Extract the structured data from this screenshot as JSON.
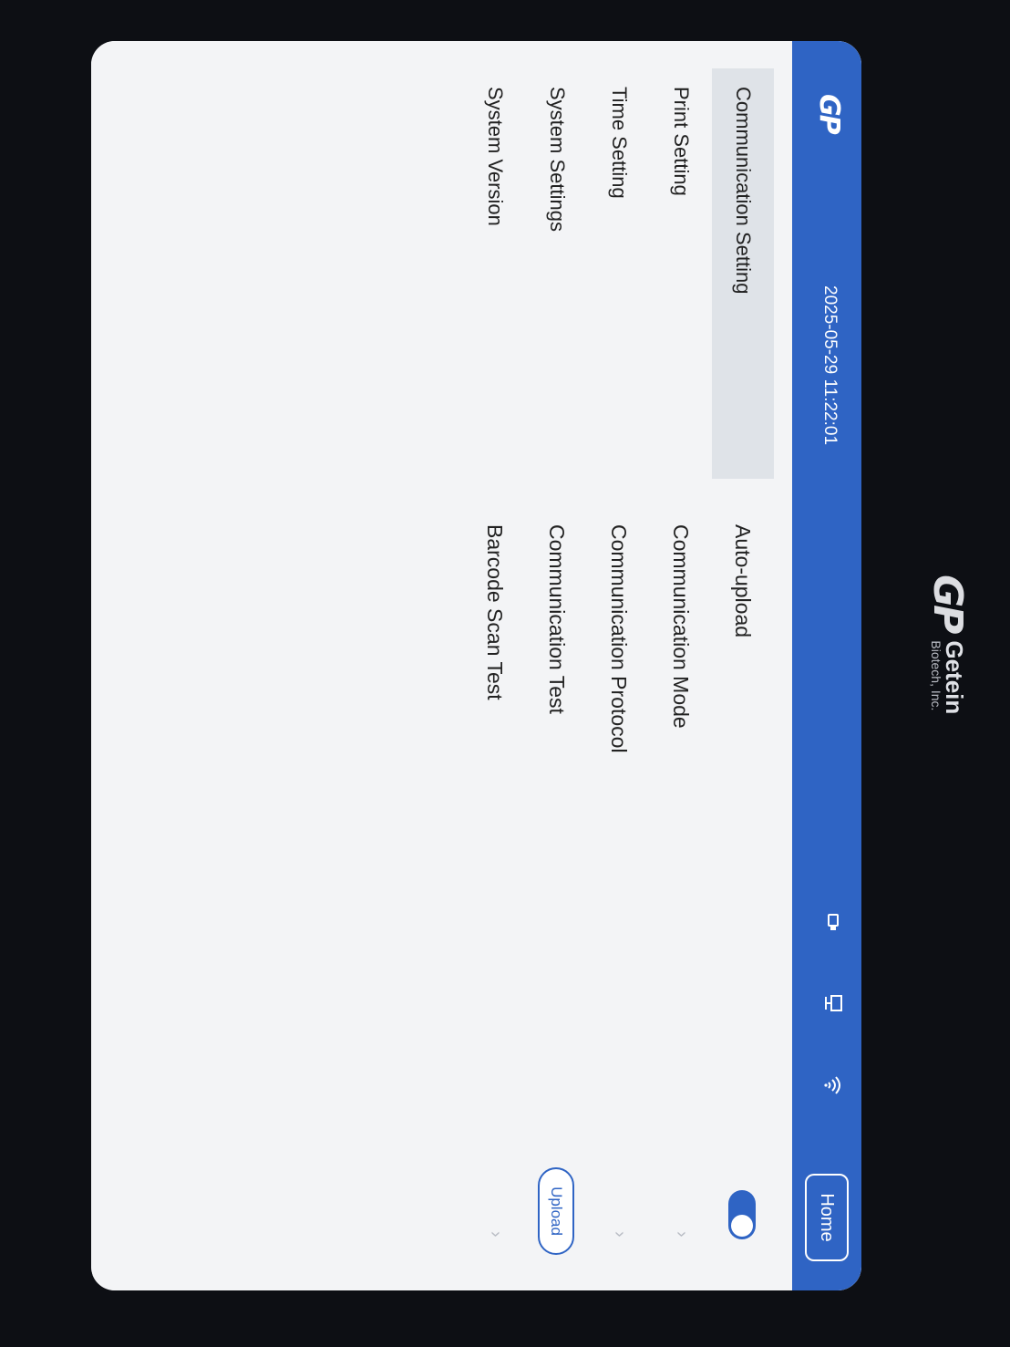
{
  "device": {
    "brand_logo": "GP",
    "brand_name": "Getein",
    "brand_sub": "Biotech, Inc."
  },
  "topbar": {
    "logo": "GP",
    "datetime": "2025-05-29 11:22:01",
    "home_label": "Home",
    "icons": [
      "usb-icon",
      "network-icon",
      "wifi-icon"
    ]
  },
  "sidebar": {
    "items": [
      {
        "label": "Communication Setting",
        "active": true
      },
      {
        "label": "Print Setting",
        "active": false
      },
      {
        "label": "Time Setting",
        "active": false
      },
      {
        "label": "System Settings",
        "active": false
      },
      {
        "label": "System Version",
        "active": false
      }
    ]
  },
  "settings": {
    "rows": [
      {
        "label": "Auto-upload",
        "control": "toggle",
        "value": true
      },
      {
        "label": "Communication Mode",
        "control": "chevron"
      },
      {
        "label": "Communication Protocol",
        "control": "chevron"
      },
      {
        "label": "Communication Test",
        "control": "button",
        "button_label": "Upload"
      },
      {
        "label": "Barcode Scan Test",
        "control": "chevron"
      }
    ]
  },
  "colors": {
    "accent": "#2f64c4",
    "active_bg": "#dfe3e8"
  }
}
